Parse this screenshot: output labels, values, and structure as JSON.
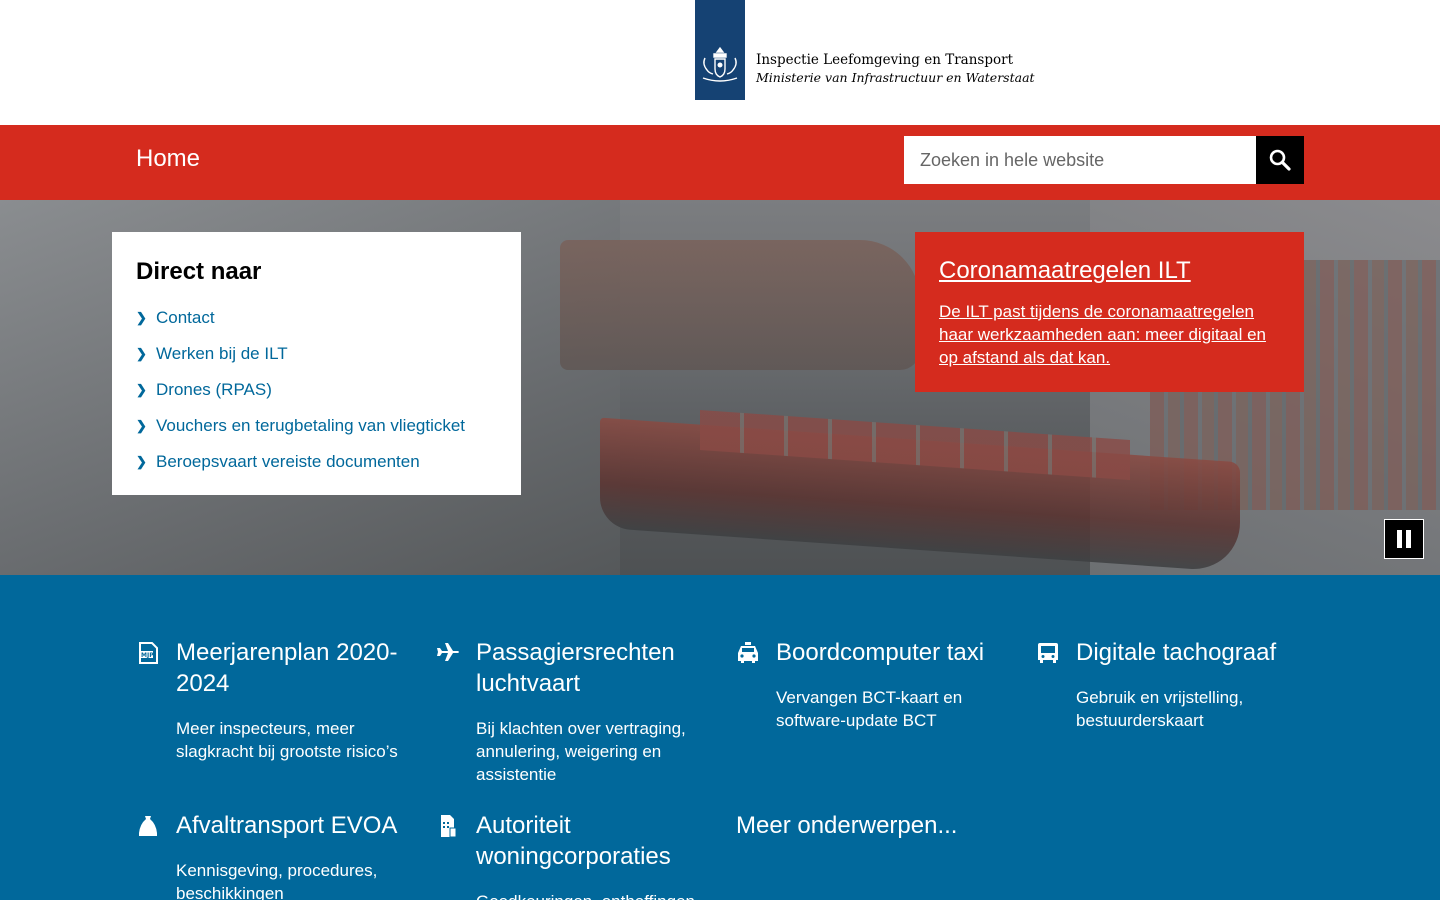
{
  "header": {
    "logo_line1": "Inspectie Leefomgeving en Transport",
    "logo_line2": "Ministerie van Infrastructuur en Waterstaat",
    "logo_color": "#154273"
  },
  "topbar": {
    "home_label": "Home",
    "search_placeholder": "Zoeken in hele website",
    "color": "#d52b1e"
  },
  "direct_naar": {
    "title": "Direct naar",
    "items": [
      {
        "label": "Contact"
      },
      {
        "label": "Werken bij de ILT"
      },
      {
        "label": "Drones (RPAS)"
      },
      {
        "label": "Vouchers en terugbetaling van vliegticket"
      },
      {
        "label": "Beroepsvaart vereiste documenten"
      }
    ]
  },
  "corona": {
    "title": "Coronamaatregelen ILT",
    "text": "De ILT past tijdens de coronamaatregelen haar werkzaamheden aan: meer digitaal en op afstand als dat kan."
  },
  "topics": {
    "items": [
      {
        "icon": "document-mjp-icon",
        "title": "Meerjarenplan 2020-2024",
        "desc": "Meer inspecteurs, meer slagkracht bij grootste risico’s"
      },
      {
        "icon": "airplane-icon",
        "title": "Passagiersrechten luchtvaart",
        "desc": "Bij klachten over vertraging, annulering, weigering en assistentie"
      },
      {
        "icon": "taxi-icon",
        "title": "Boordcomputer taxi",
        "desc": "Vervangen BCT-kaart en software-update BCT"
      },
      {
        "icon": "bus-icon",
        "title": "Digitale tachograaf",
        "desc": "Gebruik en vrijstelling, bestuurderskaart"
      },
      {
        "icon": "waste-bag-icon",
        "title": "Afvaltransport EVOA",
        "desc": "Kennisgeving, procedures, beschikkingen"
      },
      {
        "icon": "building-document-icon",
        "title": "Autoriteit woningcorporaties",
        "desc": "Goedkeuringen, ontheffingen"
      }
    ],
    "more_label": "Meer onderwerpen...",
    "color": "#01689b"
  }
}
